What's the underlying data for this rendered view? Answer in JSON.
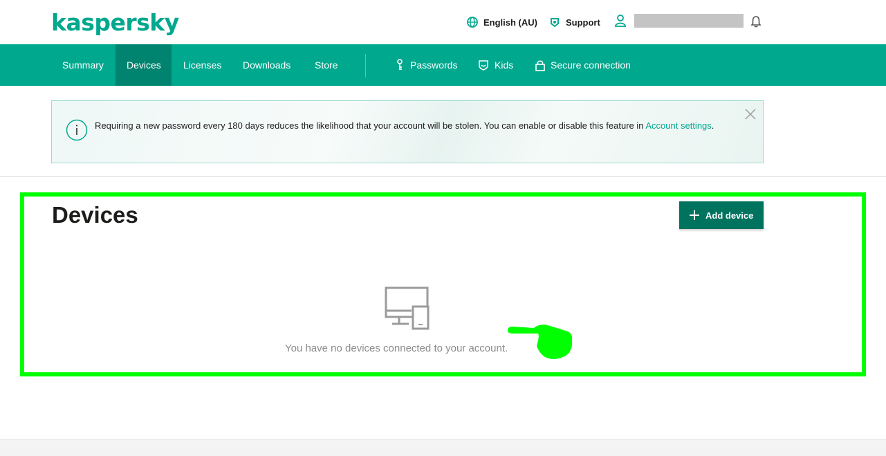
{
  "header": {
    "logo": "kaspersky",
    "language": "English (AU)",
    "support": "Support",
    "user_name": ""
  },
  "nav": {
    "items": [
      {
        "label": "Summary"
      },
      {
        "label": "Devices"
      },
      {
        "label": "Licenses"
      },
      {
        "label": "Downloads"
      },
      {
        "label": "Store"
      },
      {
        "label": "Passwords"
      },
      {
        "label": "Kids"
      },
      {
        "label": "Secure connection"
      }
    ],
    "active": "Devices"
  },
  "notice": {
    "text": "Requiring a new password every 180 days reduces the likelihood that your account will be stolen. You can enable or disable this feature in ",
    "link": "Account settings",
    "suffix": "."
  },
  "main": {
    "title": "Devices",
    "add_button": "Add device",
    "empty_message": "You have no devices connected to your account."
  },
  "colors": {
    "brand": "#00a88e",
    "nav_active": "#00836f",
    "button": "#00735f",
    "highlight": "#00ff00"
  },
  "icons": [
    "globe-icon",
    "support-icon",
    "user-icon",
    "bell-icon",
    "key-icon",
    "kids-icon",
    "lock-icon",
    "info-icon",
    "close-icon",
    "plus-icon",
    "devices-icon",
    "pointing-hand-icon"
  ]
}
